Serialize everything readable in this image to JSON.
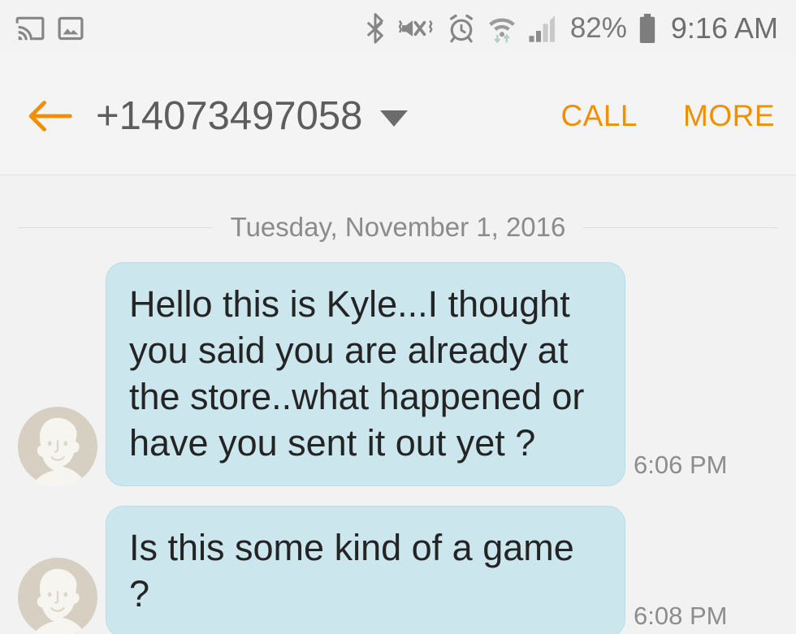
{
  "status_bar": {
    "left_icons": [
      {
        "name": "cast-icon",
        "label": "Screen cast"
      },
      {
        "name": "screenshot-image-icon",
        "label": "Screenshot saved"
      }
    ],
    "right_icons": [
      {
        "name": "bluetooth-icon",
        "label": "Bluetooth"
      },
      {
        "name": "mute-vibrate-icon",
        "label": "Sound muted / vibrate"
      },
      {
        "name": "alarm-clock-icon",
        "label": "Alarm set"
      },
      {
        "name": "wifi-data-icon",
        "label": "Wi-Fi"
      },
      {
        "name": "signal-bars-icon",
        "label": "Cellular signal"
      }
    ],
    "battery_percent": "82%",
    "clock": "9:16 AM"
  },
  "app_bar": {
    "back_icon": "back-arrow-icon",
    "contact": "+14073497058",
    "dropdown_icon": "chevron-down-icon",
    "call_label": "CALL",
    "more_label": "MORE",
    "accent_color": "#f09000"
  },
  "conversation": {
    "date_divider": "Tuesday, November 1, 2016",
    "bubble_color": "#cbe7ed",
    "messages": [
      {
        "sender": "incoming",
        "avatar": "default-person-avatar",
        "text": "Hello this is Kyle...I thought you said you are already at the store..what happened or have you sent it out yet ?",
        "time": "6:06 PM"
      },
      {
        "sender": "incoming",
        "avatar": "default-person-avatar",
        "text": "Is this some kind of a game ?",
        "time": "6:08 PM"
      }
    ]
  }
}
